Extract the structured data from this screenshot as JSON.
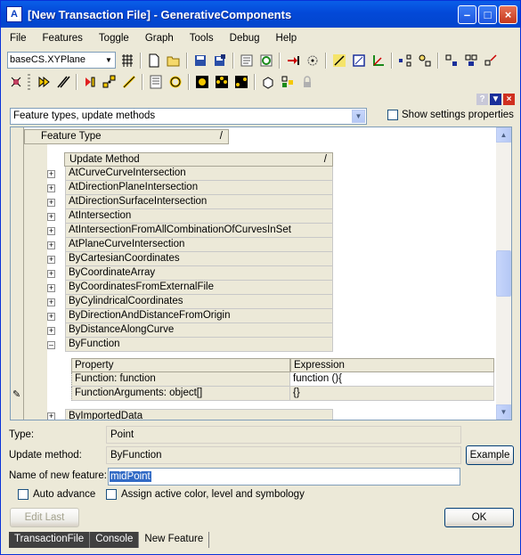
{
  "window": {
    "title": "[New Transaction File] - GenerativeComponents"
  },
  "menu": [
    "File",
    "Features",
    "Toggle",
    "Graph",
    "Tools",
    "Debug",
    "Help"
  ],
  "toolbar": {
    "plane_select": "baseCS.XYPlane"
  },
  "panel": {
    "view_select": "Feature types, update methods",
    "show_settings_label": "Show settings properties"
  },
  "grid": {
    "feature_type_header": "Feature Type",
    "update_method_header": "Update Method",
    "sort_mark": "/",
    "methods": [
      "AtCurveCurveIntersection",
      "AtDirectionPlaneIntersection",
      "AtDirectionSurfaceIntersection",
      "AtIntersection",
      "AtIntersectionFromAllCombinationOfCurvesInSet",
      "AtPlaneCurveIntersection",
      "ByCartesianCoordinates",
      "ByCoordinateArray",
      "ByCoordinatesFromExternalFile",
      "ByCylindricalCoordinates",
      "ByDirectionAndDistanceFromOrigin",
      "ByDistanceAlongCurve",
      "ByFunction"
    ],
    "expanded_method": "ByFunction",
    "next_method": "ByImportedData",
    "props": {
      "header_property": "Property",
      "header_expression": "Expression",
      "rows": [
        {
          "property": "Function: function",
          "expression": "function (){"
        },
        {
          "property": "FunctionArguments: object[]",
          "expression": "{}"
        }
      ]
    }
  },
  "form": {
    "type_label": "Type:",
    "type_value": "Point",
    "update_method_label": "Update method:",
    "update_method_value": "ByFunction",
    "example_button": "Example",
    "name_label": "Name of new feature:",
    "name_value": "midPoint",
    "auto_advance_label": "Auto advance",
    "assign_label": "Assign active color, level and symbology",
    "edit_last_button": "Edit Last",
    "ok_button": "OK"
  },
  "tabs": [
    "TransactionFile",
    "Console",
    "New Feature"
  ],
  "active_tab": "New Feature",
  "colors": {
    "titlebar": "#0A5FE8",
    "selection": "#316AC5",
    "face": "#ECE9D8"
  }
}
